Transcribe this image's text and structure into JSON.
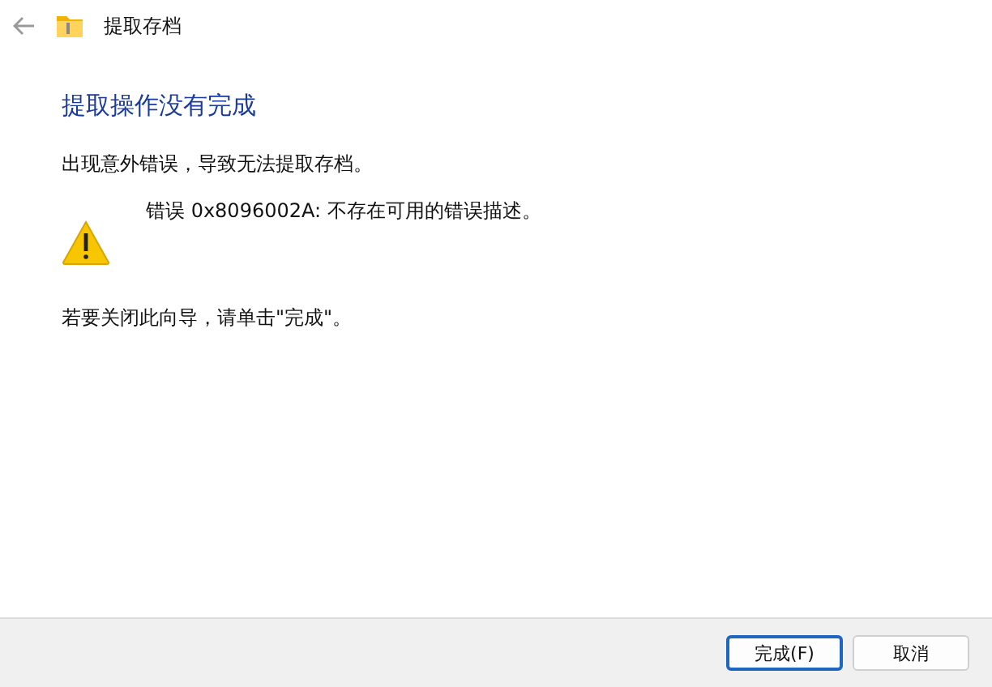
{
  "window": {
    "title": "提取存档"
  },
  "heading": "提取操作没有完成",
  "message": "出现意外错误，导致无法提取存档。",
  "error": {
    "kind": "warning",
    "text": "错误 0x8096002A: 不存在可用的错误描述。"
  },
  "instruction": "若要关闭此向导，请单击\"完成\"。",
  "buttons": [
    {
      "label": "完成(F)",
      "selected": true
    },
    {
      "label": "取消",
      "selected": false
    }
  ]
}
